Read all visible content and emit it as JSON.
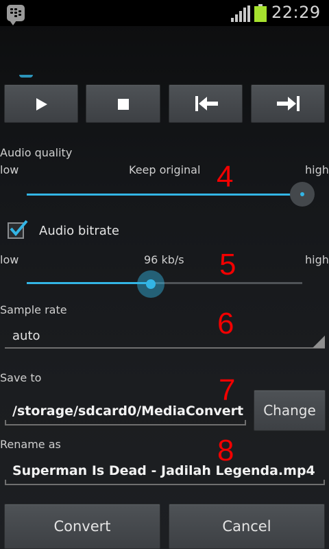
{
  "status_bar": {
    "time": "22:29",
    "notification_icon": "bbm-chat-icon",
    "signal_icon": "signal-bars-icon",
    "battery_icon": "battery-icon",
    "battery_color": "#a6e22e"
  },
  "media_controls": [
    {
      "name": "play",
      "icon": "play-icon"
    },
    {
      "name": "stop",
      "icon": "stop-icon"
    },
    {
      "name": "previous",
      "icon": "skip-back-icon"
    },
    {
      "name": "next",
      "icon": "skip-forward-icon"
    }
  ],
  "audio_quality": {
    "label": "Audio quality",
    "low": "low",
    "value": "Keep original",
    "high": "high",
    "level": 1.0,
    "annotation": "4"
  },
  "audio_bitrate": {
    "label": "Audio bitrate",
    "checked": true,
    "low": "low",
    "value": "96 kb/s",
    "high": "high",
    "level": 0.45,
    "annotation": "5"
  },
  "sample_rate": {
    "label": "Sample rate",
    "value": "auto",
    "annotation": "6"
  },
  "save_to": {
    "label": "Save to",
    "value": "/storage/sdcard0/MediaConvert",
    "change_label": "Change",
    "annotation": "7"
  },
  "rename_as": {
    "label": "Rename as",
    "value": "Superman Is Dead - Jadilah Legenda.mp4",
    "annotation": "8"
  },
  "actions": {
    "convert_label": "Convert",
    "cancel_label": "Cancel"
  },
  "colors": {
    "accent": "#33b5e5",
    "annotation": "#f20000"
  }
}
